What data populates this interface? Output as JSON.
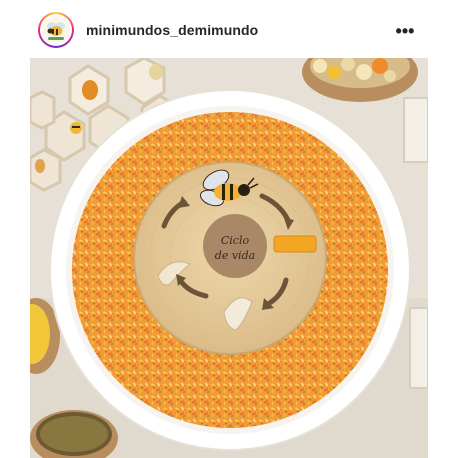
{
  "post": {
    "username": "minimundos_demimundo",
    "more_icon": "more-horizontal-icon",
    "more_label": "•••",
    "avatar_icon": "profile-avatar"
  },
  "photo": {
    "center_label_line1": "Ciclo",
    "center_label_line2": "de vida",
    "colors": {
      "table": "#e9e4dc",
      "tray_rim": "#ffffff",
      "sprinkles": "#f2a23a",
      "wood_board": "#e7cfa1",
      "label_disc": "#a88866"
    }
  }
}
